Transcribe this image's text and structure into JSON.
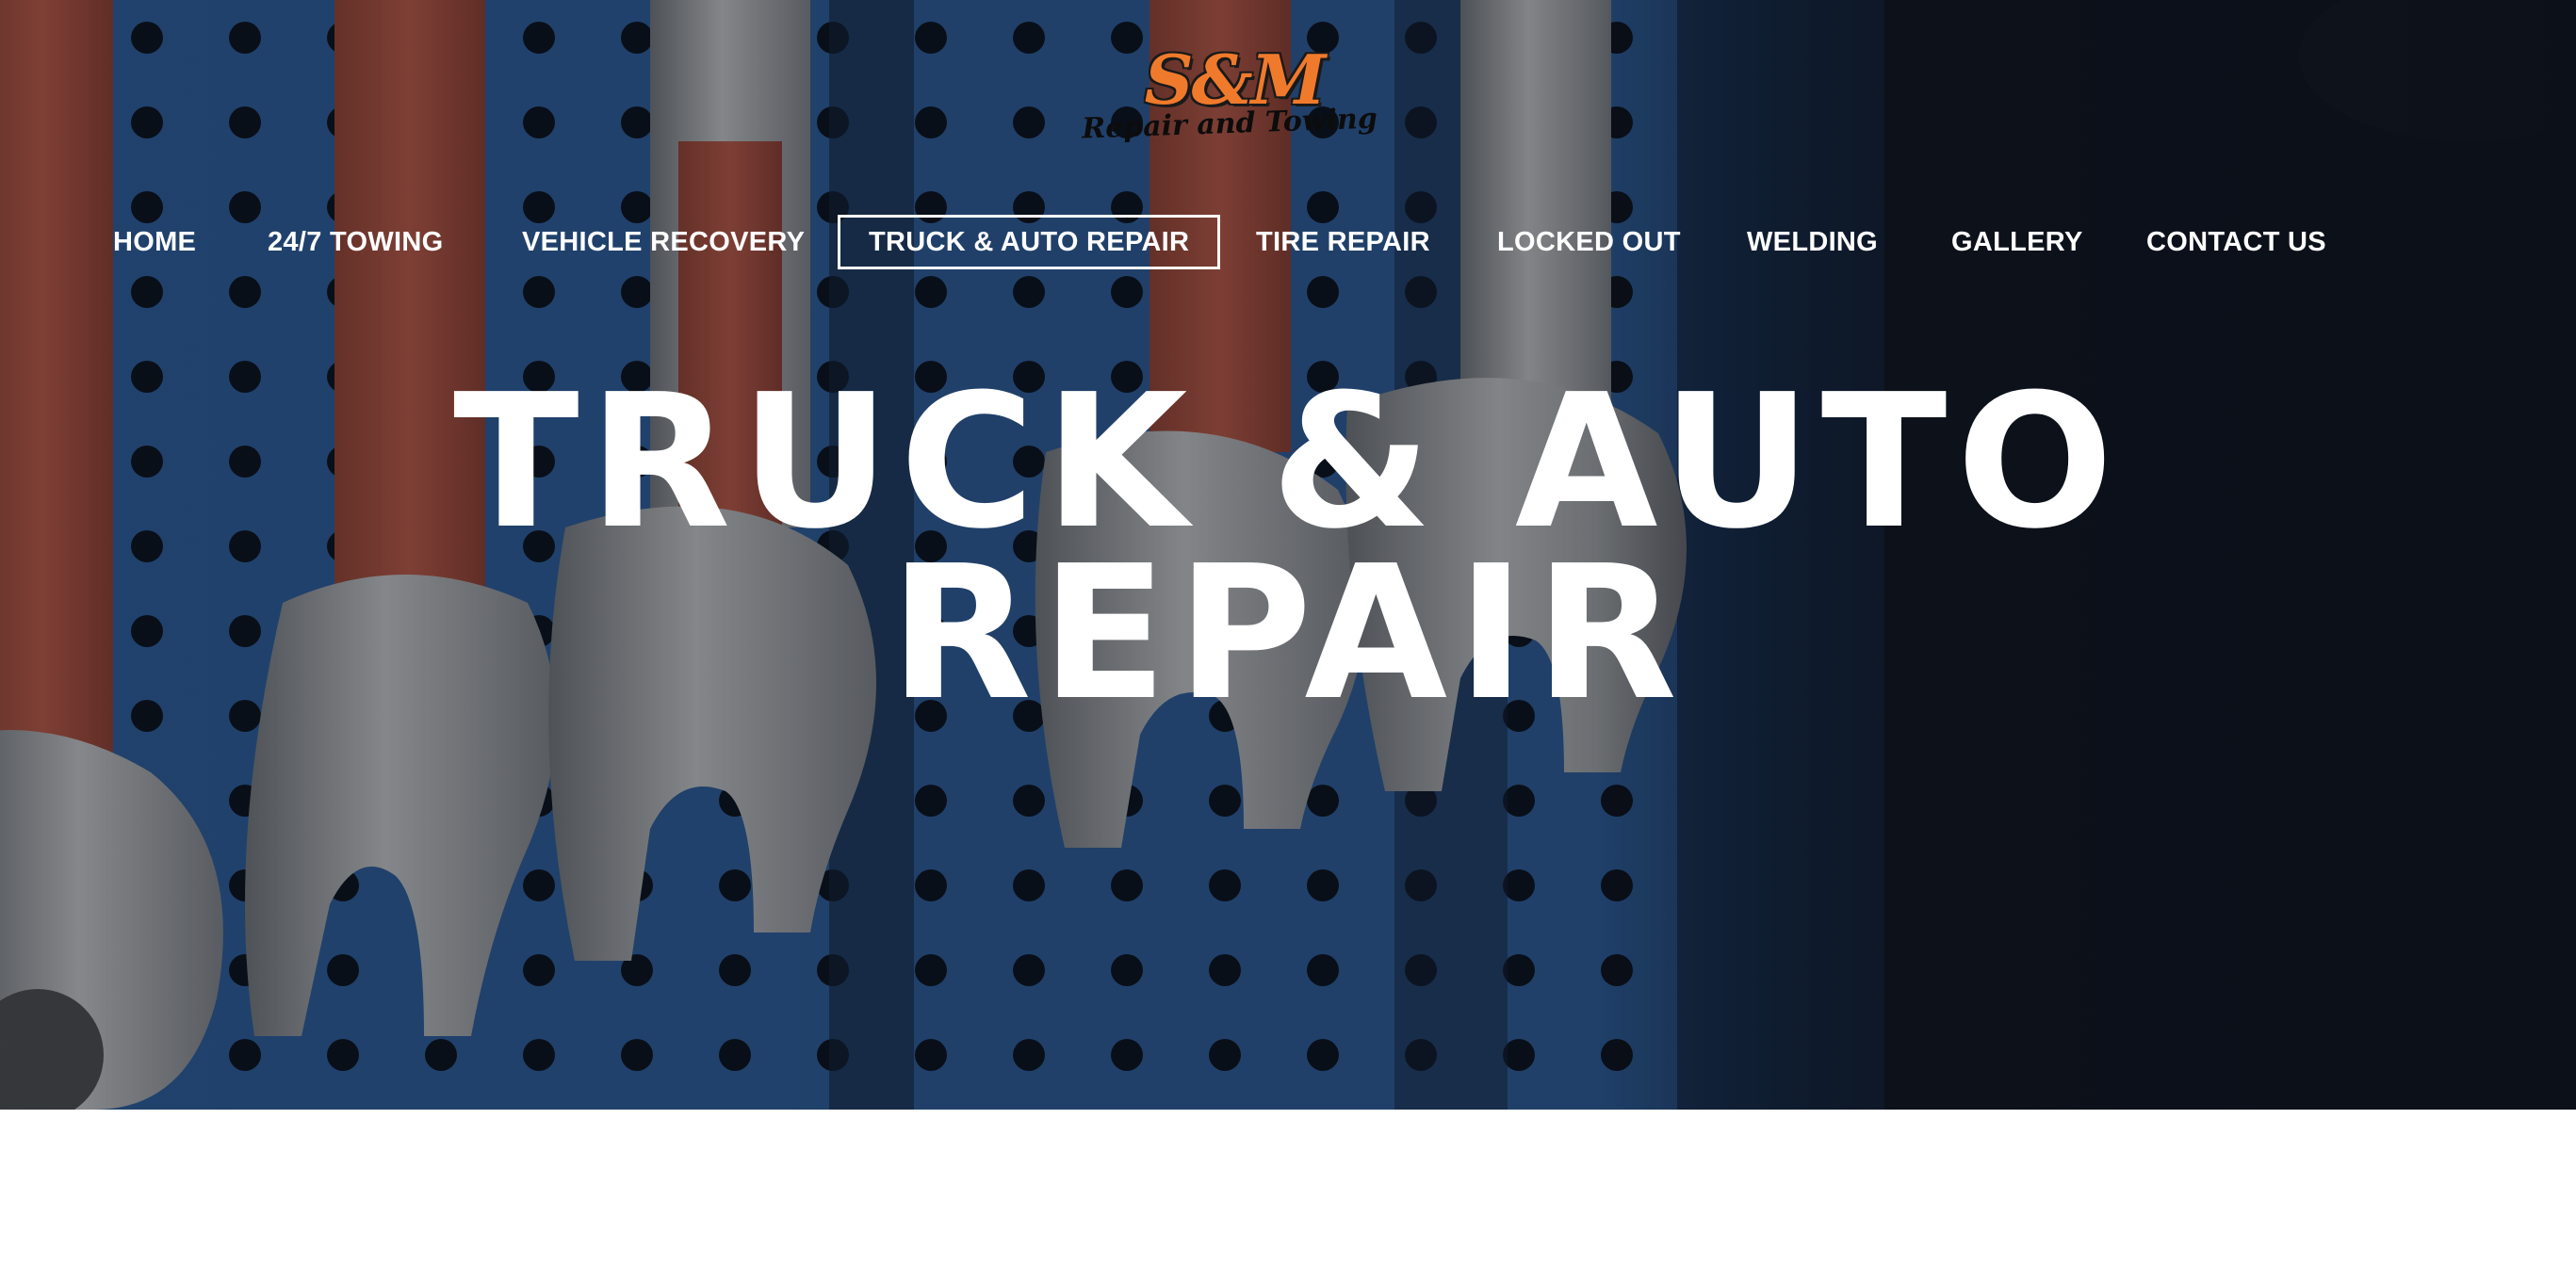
{
  "logo": {
    "mark": "S&M",
    "tagline": "Repair and Towing"
  },
  "nav": {
    "items": [
      {
        "label": "HOME"
      },
      {
        "label": "24/7 TOWING"
      },
      {
        "label": "VEHICLE RECOVERY"
      },
      {
        "label": "TRUCK & AUTO REPAIR",
        "active": true
      },
      {
        "label": "TIRE REPAIR"
      },
      {
        "label": "LOCKED OUT"
      },
      {
        "label": "WELDING"
      },
      {
        "label": "GALLERY"
      },
      {
        "label": "CONTACT US"
      }
    ]
  },
  "hero": {
    "title_line1": "TRUCK & AUTO",
    "title_line2": "REPAIR"
  },
  "colors": {
    "brand_orange": "#f07a2b",
    "pegboard_blue": "#2f5e9b",
    "overlay_dark": "#0f1520",
    "text_white": "#ffffff"
  }
}
